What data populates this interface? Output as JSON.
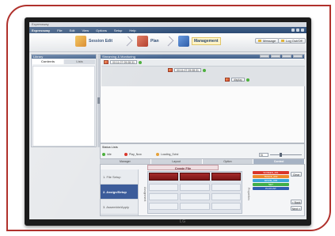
{
  "app": {
    "title": "Expressway"
  },
  "menu": {
    "brand": "Expressway",
    "items": [
      "File",
      "Edit",
      "View",
      "Options",
      "Setup",
      "Help"
    ]
  },
  "workflow": {
    "steps": [
      {
        "label": "Session Edit",
        "icon": "film-reel-icon"
      },
      {
        "label": "Plan",
        "icon": "calendar-plan-icon"
      },
      {
        "label": "Management",
        "icon": "monitor-icon"
      }
    ],
    "active": "Management",
    "message_label": "Message",
    "logout_label": "Log Out/Off"
  },
  "left_panel": {
    "title": "Library",
    "tabs": [
      "Contents",
      "Lists"
    ],
    "active_tab": "Contents"
  },
  "monitoring": {
    "title": "Streaming & Monitoring",
    "nodes": [
      {
        "label": "00:11:07 09:08:31",
        "status": "ok"
      },
      {
        "label": "00:11:07 09:08:31",
        "status": "ok"
      },
      {
        "label": "display",
        "status": "ok"
      }
    ]
  },
  "legend": {
    "title": "Status Lists",
    "items": [
      {
        "label": "Idle",
        "color": "#4caf3c"
      },
      {
        "label": "Play_Now",
        "color": "#d9362b"
      },
      {
        "label": "Loading_Schd",
        "color": "#e6a23a"
      }
    ],
    "zoom_value": "fit"
  },
  "bottom": {
    "tabs": [
      "Manager",
      "Layout",
      "Option",
      "Control"
    ],
    "active_tab": "Control",
    "steps": [
      "1. File Setup",
      "2. Assign/Setup",
      "3. Assemble/Apply"
    ],
    "active_step": "2. Assign/Setup",
    "create_title": "Create File",
    "side_label_left": "Assignment",
    "side_label_right": "Properties",
    "chips": [
      {
        "label": "SCREEN_001",
        "color": "#d9362b"
      },
      {
        "label": "TRACK_002",
        "color": "#ee8a2a"
      },
      {
        "label": "MOVIE_003",
        "color": "#3ba6d8"
      },
      {
        "label": "NET",
        "color": "#3fae49"
      },
      {
        "label": "PLAYLIST",
        "color": "#2f5fb0"
      }
    ],
    "clear_label": "Clear",
    "back_label": "< Back",
    "next_label": "Next >"
  },
  "bezel": {
    "brand": "LG"
  }
}
